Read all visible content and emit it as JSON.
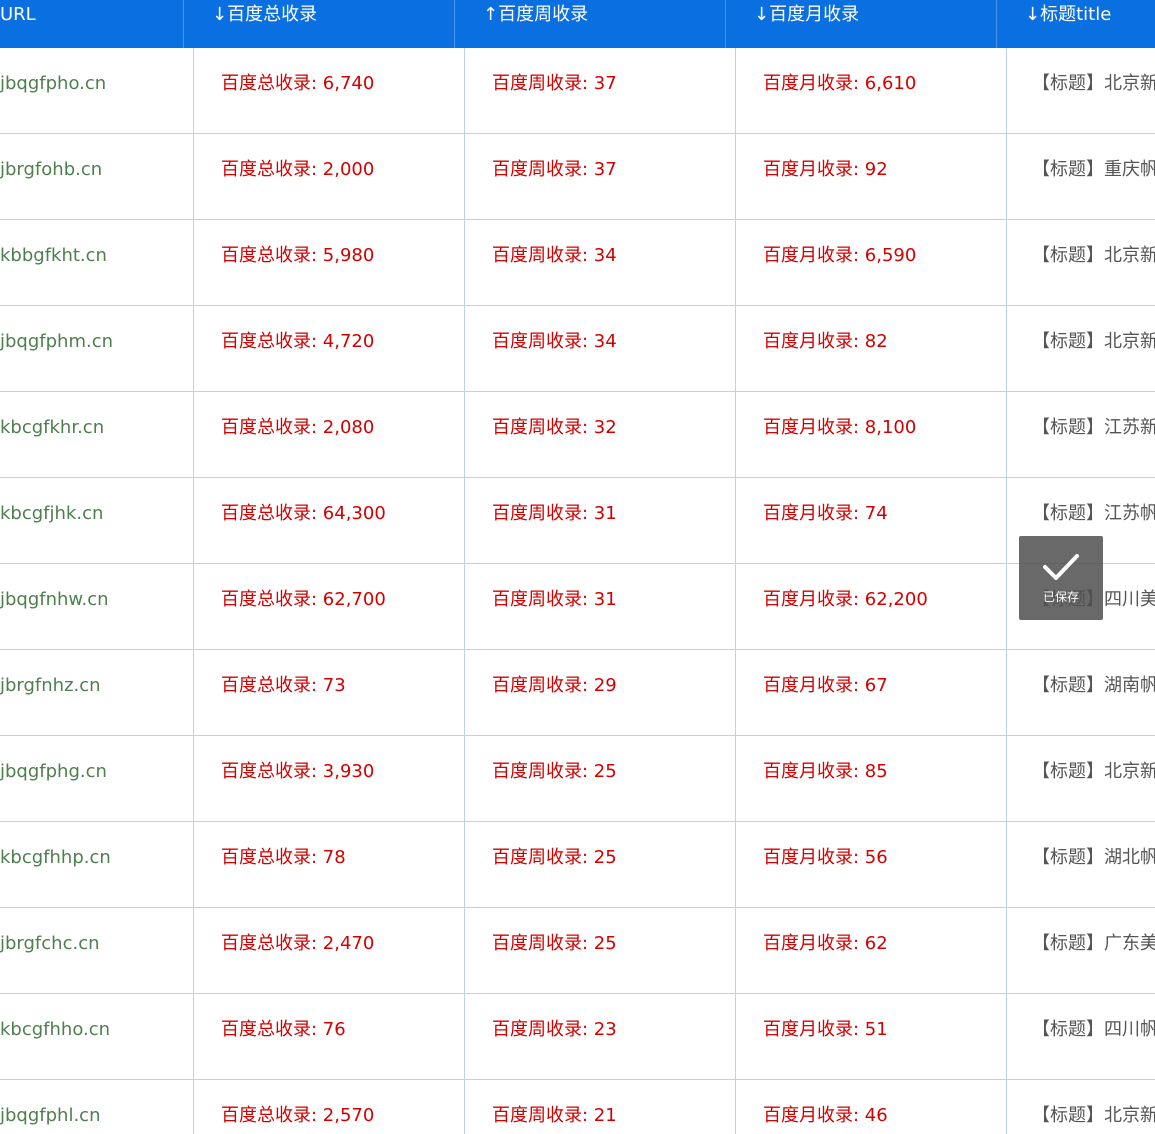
{
  "header": {
    "url": "URL",
    "total": "↓百度总收录",
    "week": "↑百度周收录",
    "month": "↓百度月收录",
    "title": "↓标题title"
  },
  "rows": [
    {
      "url": "jbqgfpho.cn",
      "total": "百度总收录: 6,740",
      "week": "百度周收录: 37",
      "month": "百度月收录: 6,610",
      "title": "【标题】北京新"
    },
    {
      "url": "jbrgfohb.cn",
      "total": "百度总收录: 2,000",
      "week": "百度周收录: 37",
      "month": "百度月收录: 92",
      "title": "【标题】重庆帆"
    },
    {
      "url": "kbbgfkht.cn",
      "total": "百度总收录: 5,980",
      "week": "百度周收录: 34",
      "month": "百度月收录: 6,590",
      "title": "【标题】北京新"
    },
    {
      "url": "jbqgfphm.cn",
      "total": "百度总收录: 4,720",
      "week": "百度周收录: 34",
      "month": "百度月收录: 82",
      "title": "【标题】北京新"
    },
    {
      "url": "kbcgfkhr.cn",
      "total": "百度总收录: 2,080",
      "week": "百度周收录: 32",
      "month": "百度月收录: 8,100",
      "title": "【标题】江苏新"
    },
    {
      "url": "kbcgfjhk.cn",
      "total": "百度总收录: 64,300",
      "week": "百度周收录: 31",
      "month": "百度月收录: 74",
      "title": "【标题】江苏帆"
    },
    {
      "url": "jbqgfnhw.cn",
      "total": "百度总收录: 62,700",
      "week": "百度周收录: 31",
      "month": "百度月收录: 62,200",
      "title": "【标题】四川美"
    },
    {
      "url": "jbrgfnhz.cn",
      "total": "百度总收录: 73",
      "week": "百度周收录: 29",
      "month": "百度月收录: 67",
      "title": "【标题】湖南帆"
    },
    {
      "url": "jbqgfphg.cn",
      "total": "百度总收录: 3,930",
      "week": "百度周收录: 25",
      "month": "百度月收录: 85",
      "title": "【标题】北京新"
    },
    {
      "url": "kbcgfhhp.cn",
      "total": "百度总收录: 78",
      "week": "百度周收录: 25",
      "month": "百度月收录: 56",
      "title": "【标题】湖北帆"
    },
    {
      "url": "jbrgfchc.cn",
      "total": "百度总收录: 2,470",
      "week": "百度周收录: 25",
      "month": "百度月收录: 62",
      "title": "【标题】广东美"
    },
    {
      "url": "kbcgfhho.cn",
      "total": "百度总收录: 76",
      "week": "百度周收录: 23",
      "month": "百度月收录: 51",
      "title": "【标题】四川帆"
    },
    {
      "url": "jbqgfphl.cn",
      "total": "百度总收录: 2,570",
      "week": "百度周收录: 21",
      "month": "百度月收录: 46",
      "title": "【标题】北京新"
    }
  ],
  "toast": {
    "icon": "checkmark-icon",
    "label": "已保存"
  },
  "colors": {
    "header_bg": "#0a6fe0",
    "url_text": "#4e7f4e",
    "metric_text": "#d40000",
    "title_text": "#555555",
    "grid_line": "#b7d4ea"
  }
}
